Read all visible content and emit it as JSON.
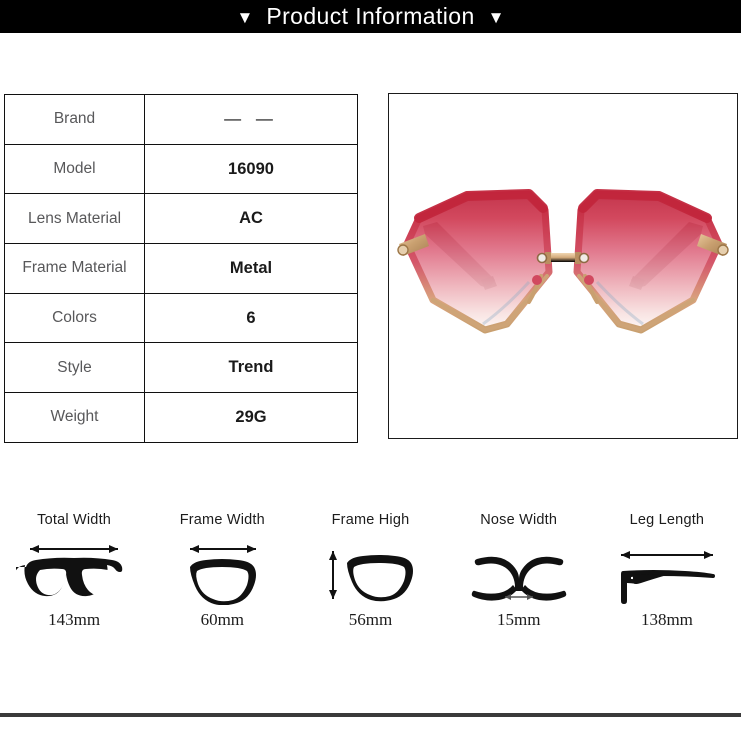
{
  "banner": {
    "left_triangle": "▼",
    "title": "Product Information",
    "right_triangle": "▼"
  },
  "spec_table": {
    "rows": [
      {
        "label": "Brand",
        "value": "— —"
      },
      {
        "label": "Model",
        "value": "16090"
      },
      {
        "label": "Lens Material",
        "value": "AC"
      },
      {
        "label": "Frame Material",
        "value": "Metal"
      },
      {
        "label": "Colors",
        "value": "6"
      },
      {
        "label": "Style",
        "value": "Trend"
      },
      {
        "label": "Weight",
        "value": "29G"
      }
    ]
  },
  "product_image": {
    "alt": "Rimless polygonal cat-eye sunglasses with red to pink gradient lenses and gold metal temples",
    "colors": {
      "lens_top": "#c52b44",
      "lens_mid": "#e0788c",
      "lens_bottom": "#fbf0ef",
      "frame_red": "#c8283c",
      "gold": "#c9a070",
      "temple_dark": "#5c1f22",
      "background": "#ffffff"
    }
  },
  "measurements": [
    {
      "label": "Total Width",
      "value": "143mm",
      "icon": "full-frame-width-icon"
    },
    {
      "label": "Frame Width",
      "value": "60mm",
      "icon": "single-lens-width-icon"
    },
    {
      "label": "Frame High",
      "value": "56mm",
      "icon": "single-lens-height-icon"
    },
    {
      "label": "Nose Width",
      "value": "15mm",
      "icon": "nose-bridge-width-icon"
    },
    {
      "label": "Leg Length",
      "value": "138mm",
      "icon": "temple-arm-length-icon"
    }
  ]
}
